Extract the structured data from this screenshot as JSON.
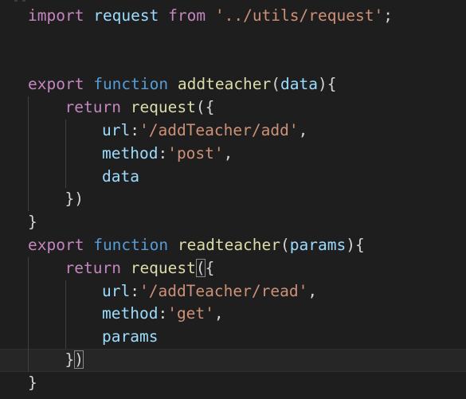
{
  "colors": {
    "background": "#1e1e1e",
    "keyword": "#c586c0",
    "storage": "#569cd6",
    "function": "#dcdcaa",
    "variable": "#9cdcfe",
    "string": "#ce9178",
    "punctuation": "#d4d4d4",
    "bracket": "#ffd700"
  },
  "lines": [
    {
      "indent": 0,
      "tokens": [
        {
          "t": "import",
          "k": "keyword"
        },
        {
          "t": " ",
          "k": "punctuation"
        },
        {
          "t": "request",
          "k": "variable"
        },
        {
          "t": " ",
          "k": "punctuation"
        },
        {
          "t": "from",
          "k": "keyword"
        },
        {
          "t": " ",
          "k": "punctuation"
        },
        {
          "t": "'../utils/request'",
          "k": "string"
        },
        {
          "t": ";",
          "k": "punctuation"
        }
      ]
    },
    {
      "indent": 0,
      "tokens": []
    },
    {
      "indent": 0,
      "tokens": []
    },
    {
      "indent": 0,
      "tokens": [
        {
          "t": "export",
          "k": "keyword"
        },
        {
          "t": " ",
          "k": "punctuation"
        },
        {
          "t": "function",
          "k": "storage"
        },
        {
          "t": " ",
          "k": "punctuation"
        },
        {
          "t": "addteacher",
          "k": "function"
        },
        {
          "t": "(",
          "k": "punctuation"
        },
        {
          "t": "data",
          "k": "variable"
        },
        {
          "t": "){",
          "k": "punctuation"
        }
      ]
    },
    {
      "indent": 1,
      "tokens": [
        {
          "t": "return",
          "k": "keyword"
        },
        {
          "t": " ",
          "k": "punctuation"
        },
        {
          "t": "request",
          "k": "function"
        },
        {
          "t": "({",
          "k": "punctuation"
        }
      ]
    },
    {
      "indent": 2,
      "tokens": [
        {
          "t": "url",
          "k": "variable"
        },
        {
          "t": ":",
          "k": "punctuation"
        },
        {
          "t": "'/addTeacher/add'",
          "k": "string"
        },
        {
          "t": ",",
          "k": "punctuation"
        }
      ]
    },
    {
      "indent": 2,
      "tokens": [
        {
          "t": "method",
          "k": "variable"
        },
        {
          "t": ":",
          "k": "punctuation"
        },
        {
          "t": "'post'",
          "k": "string"
        },
        {
          "t": ",",
          "k": "punctuation"
        }
      ]
    },
    {
      "indent": 2,
      "tokens": [
        {
          "t": "data",
          "k": "variable"
        }
      ]
    },
    {
      "indent": 1,
      "tokens": [
        {
          "t": "})",
          "k": "punctuation"
        }
      ]
    },
    {
      "indent": 0,
      "tokens": [
        {
          "t": "}",
          "k": "punctuation"
        }
      ]
    },
    {
      "indent": 0,
      "tokens": [
        {
          "t": "export",
          "k": "keyword"
        },
        {
          "t": " ",
          "k": "punctuation"
        },
        {
          "t": "function",
          "k": "storage"
        },
        {
          "t": " ",
          "k": "punctuation"
        },
        {
          "t": "readteacher",
          "k": "function"
        },
        {
          "t": "(",
          "k": "punctuation"
        },
        {
          "t": "params",
          "k": "variable"
        },
        {
          "t": "){",
          "k": "punctuation"
        }
      ]
    },
    {
      "indent": 1,
      "tokens": [
        {
          "t": "return",
          "k": "keyword"
        },
        {
          "t": " ",
          "k": "punctuation"
        },
        {
          "t": "request",
          "k": "function"
        },
        {
          "t": "(",
          "k": "punctuation",
          "match": true
        },
        {
          "t": "{",
          "k": "punctuation"
        }
      ]
    },
    {
      "indent": 2,
      "tokens": [
        {
          "t": "url",
          "k": "variable"
        },
        {
          "t": ":",
          "k": "punctuation"
        },
        {
          "t": "'/addTeacher/read'",
          "k": "string"
        },
        {
          "t": ",",
          "k": "punctuation"
        }
      ]
    },
    {
      "indent": 2,
      "tokens": [
        {
          "t": "method",
          "k": "variable"
        },
        {
          "t": ":",
          "k": "punctuation"
        },
        {
          "t": "'get'",
          "k": "string"
        },
        {
          "t": ",",
          "k": "punctuation"
        }
      ]
    },
    {
      "indent": 2,
      "tokens": [
        {
          "t": "params",
          "k": "variable"
        }
      ]
    },
    {
      "indent": 1,
      "current": true,
      "tokens": [
        {
          "t": "}",
          "k": "punctuation"
        },
        {
          "t": ")",
          "k": "punctuation",
          "match": true
        }
      ]
    },
    {
      "indent": 0,
      "tokens": [
        {
          "t": "}",
          "k": "punctuation"
        }
      ]
    }
  ]
}
